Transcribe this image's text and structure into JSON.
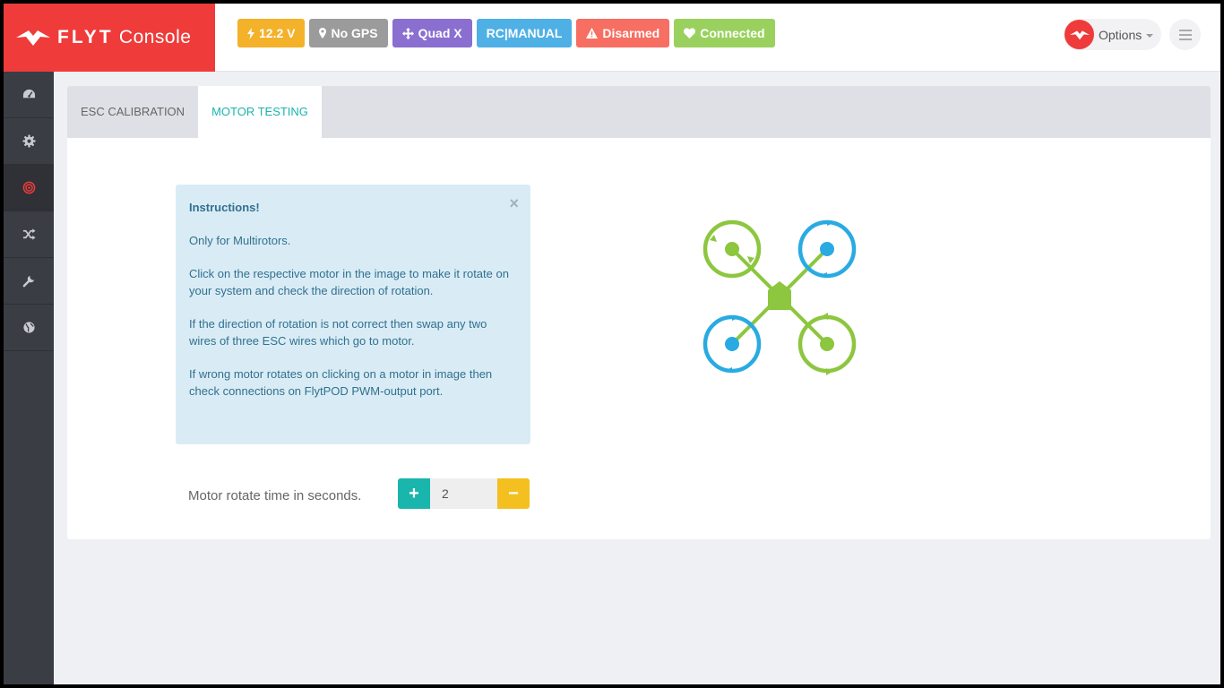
{
  "brand": {
    "name_bold": "FLYT",
    "name_light": "Console",
    "logo_icon": "flytbase-logo-icon"
  },
  "colors": {
    "brand_red": "#ef3b3a",
    "sidebar": "#3a3d44",
    "accent_teal": "#1ab5ad",
    "accent_yellow": "#f4c020",
    "motor_green": "#8dc63f",
    "motor_blue": "#29abe2"
  },
  "status_badges": [
    {
      "label": "12.2 V",
      "icon": "bolt-icon",
      "color": "#f4b12a"
    },
    {
      "label": "No GPS",
      "icon": "map-marker-icon",
      "color": "#9b9b9b"
    },
    {
      "label": "Quad X",
      "icon": "arrows-icon",
      "color": "#8a6fd0"
    },
    {
      "label": "RC|MANUAL",
      "icon": "",
      "color": "#4fb0e6"
    },
    {
      "label": "Disarmed",
      "icon": "warning-icon",
      "color": "#f76e62"
    },
    {
      "label": "Connected",
      "icon": "heart-icon",
      "color": "#9ad15e"
    }
  ],
  "header": {
    "options_label": "Options"
  },
  "sidebar": {
    "items": [
      {
        "icon": "dashboard-icon",
        "active": false
      },
      {
        "icon": "gear-icon",
        "active": false
      },
      {
        "icon": "target-icon",
        "active": true
      },
      {
        "icon": "shuffle-icon",
        "active": false
      },
      {
        "icon": "wrench-icon",
        "active": false
      },
      {
        "icon": "globe-icon",
        "active": false
      }
    ]
  },
  "tabs": [
    {
      "label": "ESC CALIBRATION",
      "active": false
    },
    {
      "label": "MOTOR TESTING",
      "active": true
    }
  ],
  "instructions": {
    "title": "Instructions!",
    "close": "×",
    "paragraphs": [
      "Only for Multirotors.",
      "Click on the respective motor in the image to make it rotate on your system and check the direction of rotation.",
      "If the direction of rotation is not correct then swap any two wires of three ESC wires which go to motor.",
      "If wrong motor rotates on clicking on a motor in image then check connections on FlytPOD PWM-output port."
    ]
  },
  "motor_time": {
    "label": "Motor rotate time in seconds.",
    "value": "2",
    "plus": "+",
    "minus": "−"
  }
}
